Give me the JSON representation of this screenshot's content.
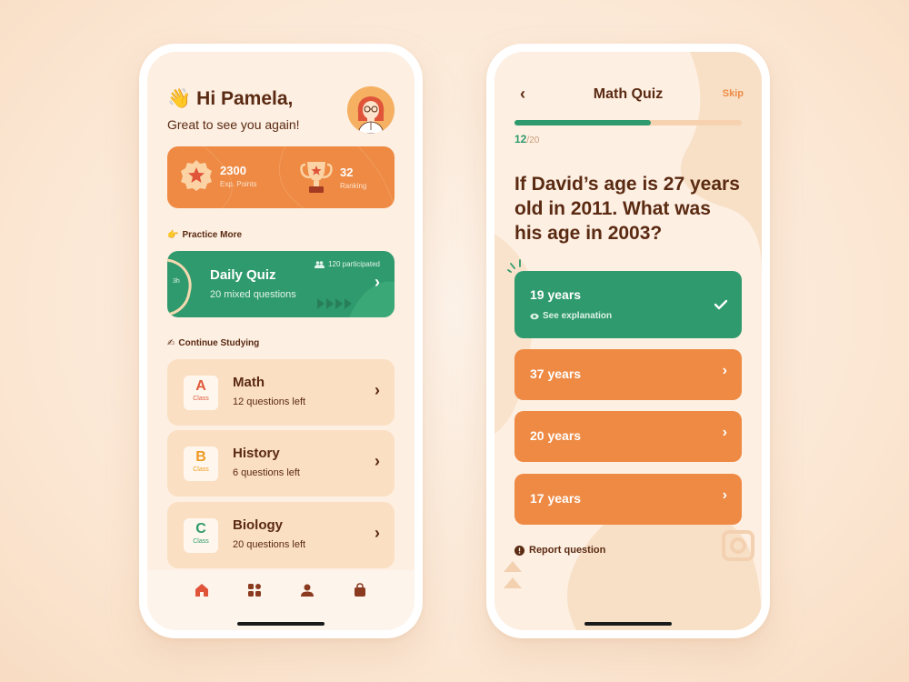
{
  "home": {
    "greeting_emoji": "👋",
    "greeting": "Hi Pamela,",
    "subtitle": "Great to see you again!",
    "stats": {
      "points_value": "2300",
      "points_label": "Exp. Points",
      "ranking_value": "32",
      "ranking_label": "Ranking"
    },
    "practice_emoji": "👉",
    "practice_label": "Practice More",
    "daily_quiz": {
      "title": "Daily Quiz",
      "subtitle": "20 mixed questions",
      "participants": "120 participated",
      "timer": "3h"
    },
    "continue_emoji": "✍",
    "continue_label": "Continue Studying",
    "courses": [
      {
        "letter": "A",
        "class_label": "Class",
        "name": "Math",
        "remaining": "12 questions left",
        "color": "#e05a3a"
      },
      {
        "letter": "B",
        "class_label": "Class",
        "name": "History",
        "remaining": "6 questions left",
        "color": "#ee9a20"
      },
      {
        "letter": "C",
        "class_label": "Class",
        "name": "Biology",
        "remaining": "20 questions left",
        "color": "#2f9a6d"
      }
    ],
    "tabs": [
      "home-icon",
      "grid-icon",
      "profile-icon",
      "bag-icon"
    ]
  },
  "quiz": {
    "title": "Math Quiz",
    "skip": "Skip",
    "progress_current": "12",
    "progress_total": "/20",
    "progress_fraction": 0.6,
    "question": "If David’s age is 27 years old in 2011. What was his age in 2003?",
    "answers": [
      {
        "label": "19  years",
        "correct": true
      },
      {
        "label": "37 years",
        "correct": false
      },
      {
        "label": "20 years",
        "correct": false
      },
      {
        "label": "17 years",
        "correct": false
      }
    ],
    "see_explanation": "See explanation",
    "report": "Report question"
  },
  "colors": {
    "orange": "#ee8a44",
    "green": "#2f9a6d",
    "brown": "#5a2a12",
    "cream": "#fdefe2",
    "peach": "#fbdfc3"
  }
}
